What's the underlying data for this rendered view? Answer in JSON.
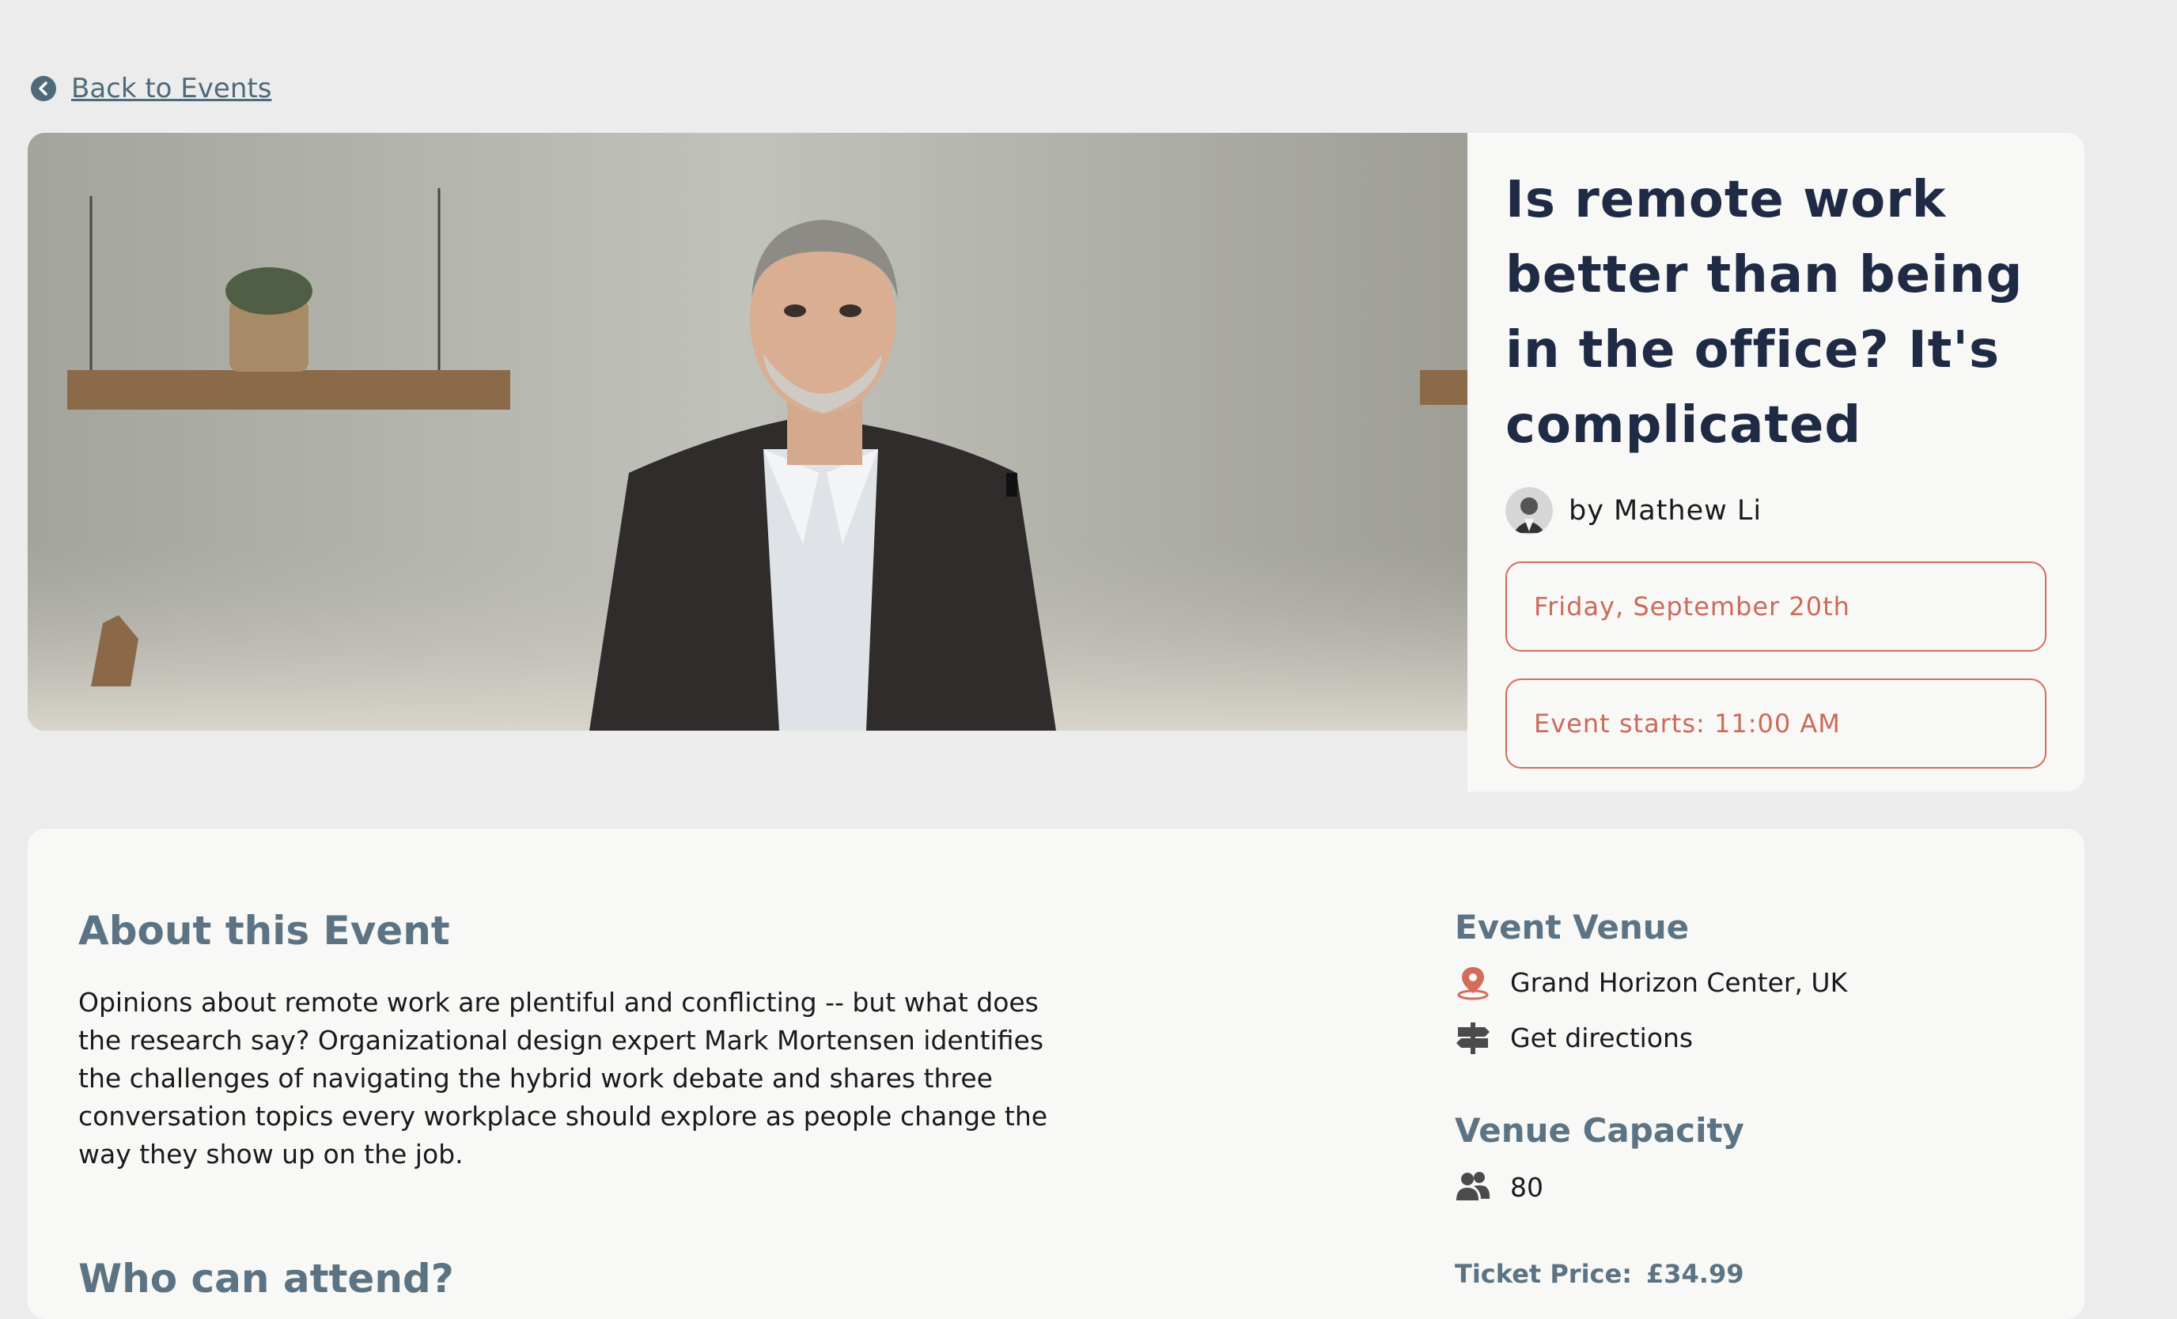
{
  "nav": {
    "back_label": "Back to Events"
  },
  "event": {
    "title": "Is remote work better than being in the office? It's complicated",
    "author": "by Mathew Li",
    "date": "Friday, September 20th",
    "start_time": "Event starts: 11:00 AM"
  },
  "about": {
    "heading": "About this Event",
    "body": "Opinions about remote work are plentiful and conflicting -- but what does the research say? Organizational design expert Mark Mortensen identifies the challenges of navigating the hybrid work debate and shares three conversation topics every workplace should explore as people change the way they show up on the job.",
    "who_heading": "Who can attend?"
  },
  "venue": {
    "heading": "Event Venue",
    "name": "Grand Horizon Center, UK",
    "directions_label": "Get directions"
  },
  "capacity": {
    "heading": "Venue Capacity",
    "value": "80"
  },
  "ticket": {
    "label": "Ticket Price:",
    "price": "£34.99"
  },
  "colors": {
    "background": "#ececec",
    "card": "#f8f8f6",
    "title": "#1f2a44",
    "heading": "#5b7383",
    "accent": "#d46c5c"
  },
  "icons": {
    "back": "chevron-left-circle-icon",
    "venue": "map-pin-icon",
    "directions": "signpost-icon",
    "capacity": "people-icon"
  }
}
